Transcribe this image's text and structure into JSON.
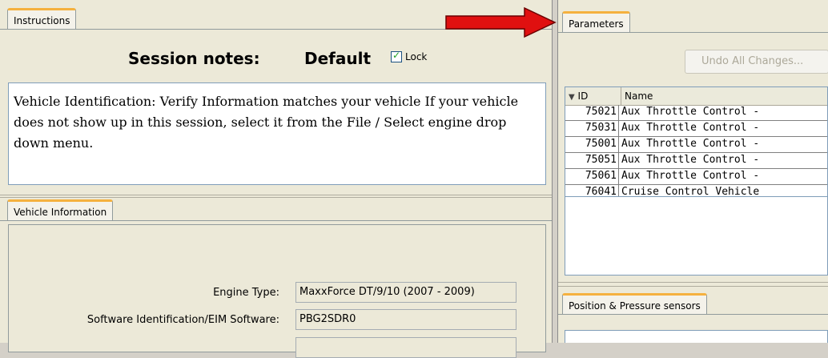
{
  "instructions_panel": {
    "tab_label": "Instructions",
    "session_notes_label": "Session notes:",
    "session_notes_value": "Default",
    "lock_label": "Lock",
    "lock_checked": true,
    "text": "Vehicle Identification: Verify Information matches your vehicle If your vehicle does not show up in this session, select it from the File / Select engine drop down menu."
  },
  "vehicle_panel": {
    "tab_label": "Vehicle Information",
    "fields": [
      {
        "label": "Engine Type:",
        "value": "MaxxForce DT/9/10 (2007 - 2009)"
      },
      {
        "label": "Software Identification/EIM Software:",
        "value": "PBG2SDR0"
      },
      {
        "label": "",
        "value": ""
      }
    ]
  },
  "parameters_panel": {
    "tab_label": "Parameters",
    "undo_button_label": "Undo All Changes...",
    "undo_enabled": false,
    "columns": [
      "ID",
      "Name"
    ],
    "rows": [
      {
        "id": "75021",
        "name": "Aux Throttle Control -"
      },
      {
        "id": "75031",
        "name": "Aux Throttle Control -"
      },
      {
        "id": "75001",
        "name": "Aux Throttle Control -"
      },
      {
        "id": "75051",
        "name": "Aux Throttle Control -"
      },
      {
        "id": "75061",
        "name": "Aux Throttle Control -"
      },
      {
        "id": "76041",
        "name": "Cruise Control Vehicle"
      }
    ]
  },
  "sensors_panel": {
    "tab_label": "Position & Pressure sensors"
  },
  "colors": {
    "tab_accent": "#f5b13f",
    "arrow": "#e01010",
    "check": "#21a121"
  }
}
